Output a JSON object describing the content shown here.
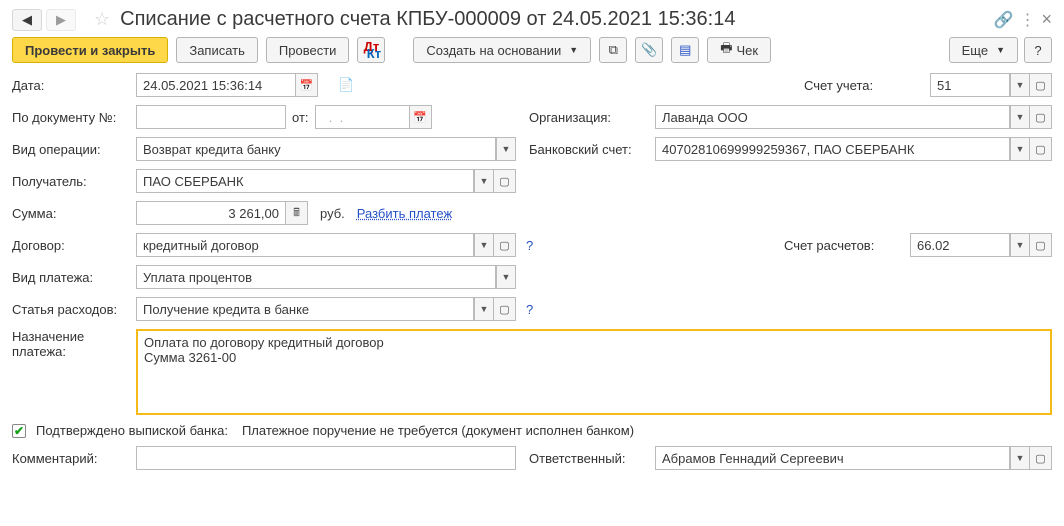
{
  "header": {
    "title": "Списание с расчетного счета КПБУ-000009 от 24.05.2021 15:36:14"
  },
  "toolbar": {
    "post_close": "Провести и закрыть",
    "save": "Записать",
    "post": "Провести",
    "create_based": "Создать на основании",
    "cheque": "Чек",
    "more": "Еще",
    "help": "?"
  },
  "labels": {
    "date": "Дата:",
    "doc_no": "По документу №:",
    "from": "от:",
    "op_type": "Вид операции:",
    "recipient": "Получатель:",
    "amount": "Сумма:",
    "rub": "руб.",
    "split": "Разбить платеж",
    "contract": "Договор:",
    "pay_type": "Вид платежа:",
    "expense": "Статья расходов:",
    "purpose": "Назначение\nплатежа:",
    "confirmed": "Подтверждено выпиской банка:",
    "confirm_text": "Платежное поручение не требуется (документ исполнен банком)",
    "comment": "Комментарий:",
    "responsible": "Ответственный:",
    "account": "Счет учета:",
    "org": "Организация:",
    "bank_acc": "Банковский счет:",
    "calc_acc": "Счет расчетов:"
  },
  "values": {
    "date": "24.05.2021 15:36:14",
    "doc_no": "",
    "from_date": "  .  .    ",
    "op_type": "Возврат кредита банку",
    "recipient": "ПАО СБЕРБАНК",
    "amount": "3 261,00",
    "contract": "кредитный договор",
    "pay_type": "Уплата процентов",
    "expense": "Получение кредита в банке",
    "purpose": "Оплата по договору кредитный договор\nСумма 3261-00",
    "comment": "",
    "responsible": "Абрамов Геннадий Сергеевич",
    "account": "51",
    "org": "Лаванда ООО",
    "bank_acc": "40702810699999259367, ПАО СБЕРБАНК",
    "calc_acc": "66.02"
  }
}
